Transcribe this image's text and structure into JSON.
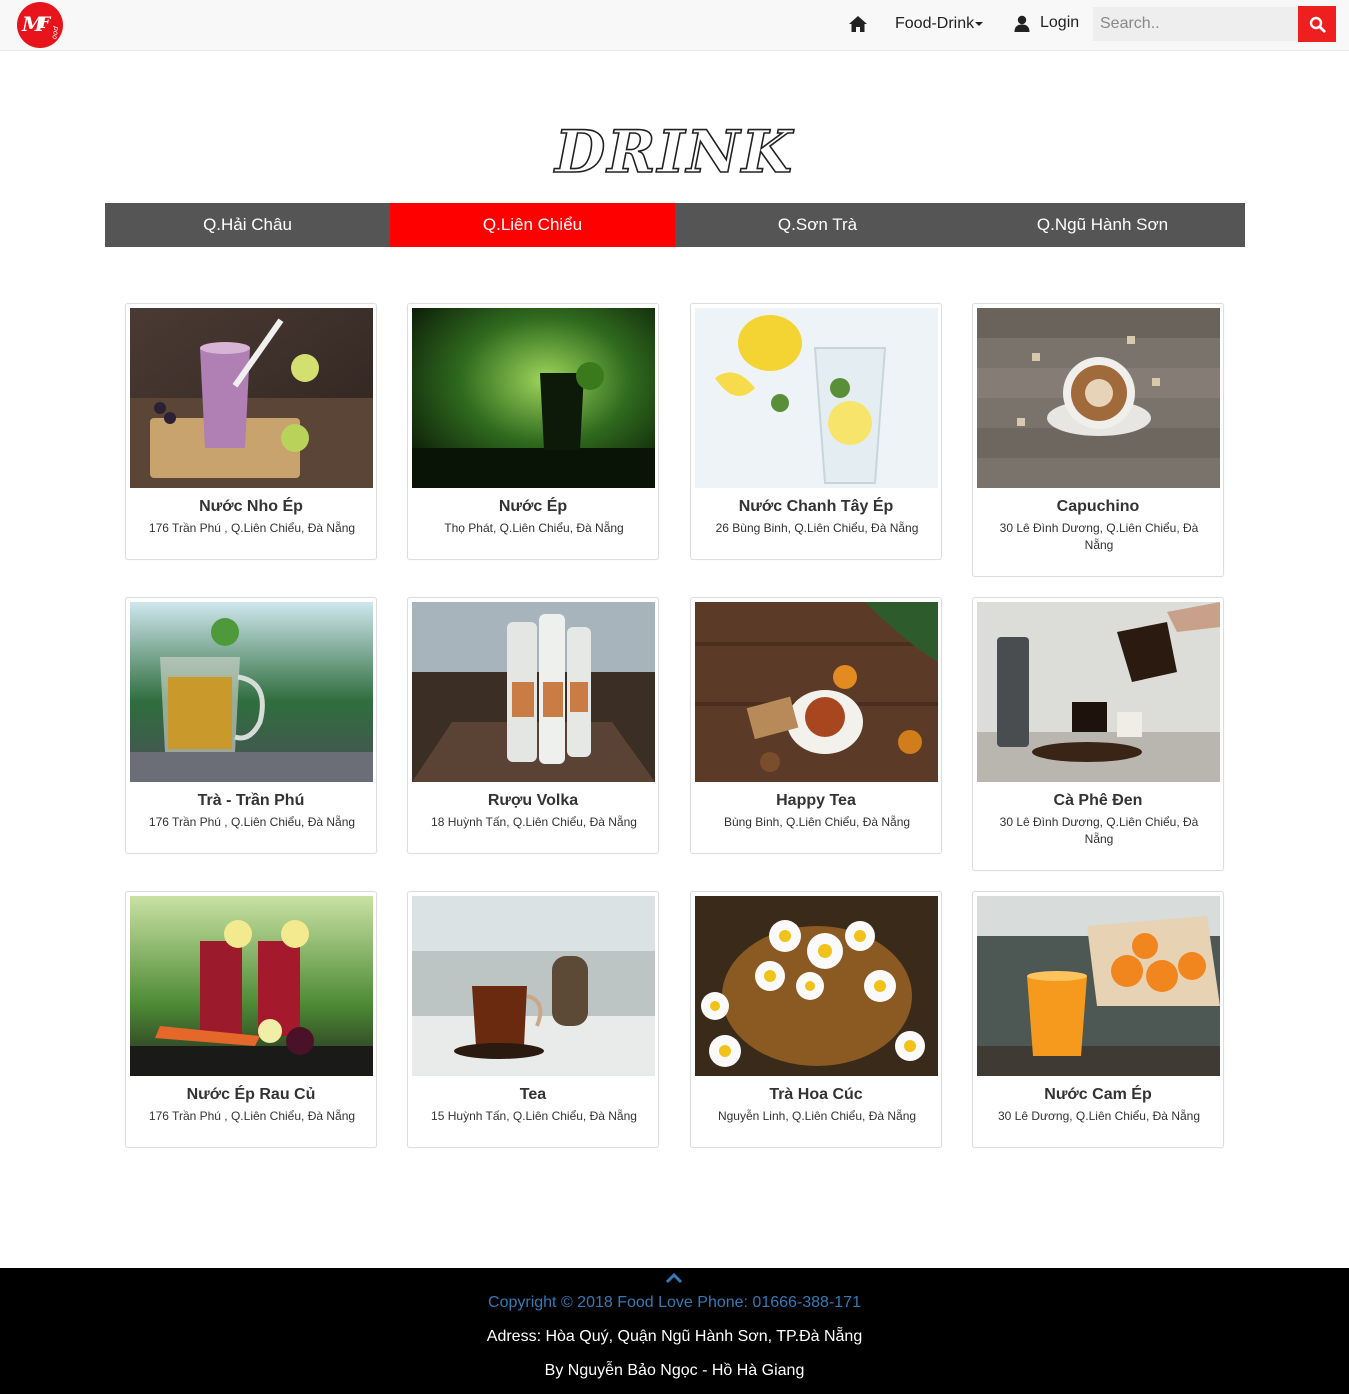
{
  "navbar": {
    "logo_text": "MFood",
    "home_icon": "home-icon",
    "food_drink_label": "Food-Drink",
    "login_label": "Login",
    "search_placeholder": "Search..",
    "search_icon": "search-icon"
  },
  "page": {
    "title": "DRINK"
  },
  "tabs": [
    {
      "label": "Q.Hải Châu",
      "active": false
    },
    {
      "label": "Q.Liên Chiểu",
      "active": true
    },
    {
      "label": "Q.Sơn Trà",
      "active": false
    },
    {
      "label": "Q.Ngũ Hành Sơn",
      "active": false
    }
  ],
  "colors": {
    "accent": "#ff0000",
    "tab_bg": "#555555",
    "footer_bg": "#000000",
    "link": "#337ab7"
  },
  "drinks": [
    {
      "name": "Nước Nho Ép",
      "address": "176 Trần Phú , Q.Liên Chiểu, Đà Nẵng",
      "image": "grape-smoothie"
    },
    {
      "name": "Nước Ép",
      "address": "Thọ Phát, Q.Liên Chiểu, Đà Nẵng",
      "image": "green-glass"
    },
    {
      "name": "Nước Chanh Tây Ép",
      "address": "26 Bùng Binh, Q.Liên Chiểu, Đà Nẵng",
      "image": "lemon-water"
    },
    {
      "name": "Capuchino",
      "address": "30 Lê Đình Dương, Q.Liên Chiểu, Đà Nẵng",
      "image": "cappuccino"
    },
    {
      "name": "Trà - Trần Phú",
      "address": "176 Trần Phú , Q.Liên Chiểu, Đà Nẵng",
      "image": "mint-tea"
    },
    {
      "name": "Rượu Volka",
      "address": "18 Huỳnh Tấn, Q.Liên Chiểu, Đà Nẵng",
      "image": "vodka-bottles"
    },
    {
      "name": "Happy Tea",
      "address": "Bùng Binh, Q.Liên Chiểu, Đà Nẵng",
      "image": "christmas-tea"
    },
    {
      "name": "Cà Phê Đen",
      "address": "30 Lê Đình Dương, Q.Liên Chiểu, Đà Nẵng",
      "image": "pour-coffee"
    },
    {
      "name": "Nước Ép Rau Củ",
      "address": "176 Trần Phú , Q.Liên Chiểu, Đà Nẵng",
      "image": "beet-juice"
    },
    {
      "name": "Tea",
      "address": "15 Huỳnh Tấn, Q.Liên Chiểu, Đà Nẵng",
      "image": "black-tea"
    },
    {
      "name": "Trà Hoa Cúc",
      "address": "Nguyễn Linh, Q.Liên Chiểu, Đà Nẵng",
      "image": "chamomile-tea"
    },
    {
      "name": "Nước Cam Ép",
      "address": "30 Lê Dương, Q.Liên Chiểu, Đà Nẵng",
      "image": "orange-juice"
    }
  ],
  "footer": {
    "up_icon": "chevron-up-icon",
    "copyright": "Copyright © 2018 Food Love Phone: 01666-388-171",
    "address": "Adress: Hòa Quý, Quận Ngũ Hành Sơn, TP.Đà Nẵng",
    "byline": "By Nguyễn Bảo Ngọc - Hồ Hà Giang"
  }
}
